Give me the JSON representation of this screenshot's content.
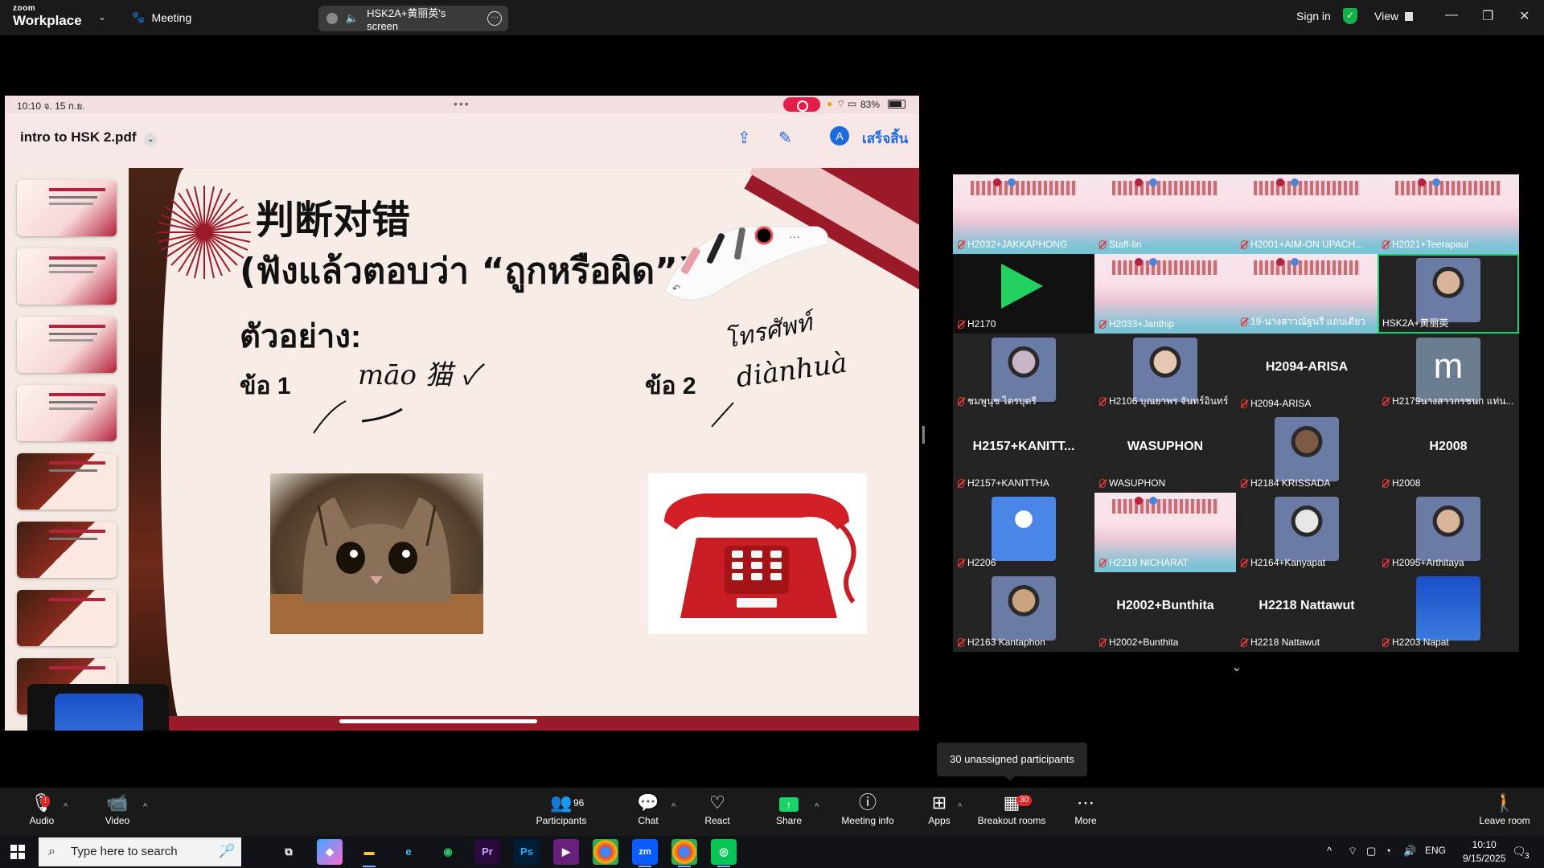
{
  "titlebar": {
    "logo_top": "zoom",
    "logo_bottom": "Workplace",
    "meeting_label": "Meeting",
    "screen_label": "HSK2A+黄丽英's screen",
    "signin_label": "Sign in",
    "view_label": "View"
  },
  "share": {
    "status_time": "10:10  จ. 15 ก.ย.",
    "battery": "83%",
    "pdf_title": "intro to HSK 2.pdf",
    "done_label": "เสร็จสิ้น",
    "slide": {
      "title_cn": "判断对错",
      "subtitle": "(ฟังแล้วตอบว่า “ถูกหรือผิด”)",
      "example": "ตัวอย่าง:",
      "q1": "ข้อ 1",
      "q2": "ข้อ 2",
      "hand_q1": "māo 猫 ✓",
      "hand_q2_thai": "โทรศัพท์",
      "hand_q2_pinyin": "diànhuà"
    }
  },
  "gallery": {
    "tiles": [
      {
        "name": "H2032+JAKKAPHONG",
        "kind": "poster"
      },
      {
        "name": "Staff-lin",
        "kind": "poster"
      },
      {
        "name": "H2001+AIM-ON UPACH...",
        "kind": "poster"
      },
      {
        "name": "H2021+Teerapaul",
        "kind": "poster"
      },
      {
        "name": "H2170",
        "kind": "logo"
      },
      {
        "name": "H2033+Janthip",
        "kind": "poster"
      },
      {
        "name": "19-นางสาวณัฐนรี แถบเดียว",
        "kind": "poster"
      },
      {
        "name": "HSK2A+黄丽英",
        "kind": "photo",
        "active": true
      },
      {
        "name": "ชมพูนุช ไตรบุตรี",
        "kind": "avatar"
      },
      {
        "name": "H2106 บุณยาพร จันทร์อินทร์",
        "kind": "photo"
      },
      {
        "name": "H2094-ARISA",
        "kind": "text",
        "big": "H2094-ARISA"
      },
      {
        "name": "H2179นางสาวกรชนก แท่น...",
        "kind": "letter",
        "big": "m"
      },
      {
        "name": "H2157+KANITTHA",
        "kind": "text",
        "big": "H2157+KANITT..."
      },
      {
        "name": "WASUPHON",
        "kind": "text",
        "big": "WASUPHON"
      },
      {
        "name": "H2184 KRISSADA",
        "kind": "photo"
      },
      {
        "name": "H2008",
        "kind": "text",
        "big": "H2008"
      },
      {
        "name": "H2206",
        "kind": "person"
      },
      {
        "name": "H2219 NICHARAT",
        "kind": "poster"
      },
      {
        "name": "H2164+Kanyapat",
        "kind": "sketch"
      },
      {
        "name": "H2095+Arthitaya",
        "kind": "photo"
      },
      {
        "name": "H2163 Kantaphon",
        "kind": "photo"
      },
      {
        "name": "H2002+Bunthita",
        "kind": "text",
        "big": "H2002+Bunthita"
      },
      {
        "name": "H2218 Nattawut",
        "kind": "text",
        "big": "H2218 Nattawut"
      },
      {
        "name": "H2203 Napat",
        "kind": "sky"
      }
    ]
  },
  "tooltip": "30 unassigned participants",
  "toolbar": {
    "audio": "Audio",
    "audio_badge": "!",
    "video": "Video",
    "participants": "Participants",
    "participants_count": "96",
    "chat": "Chat",
    "react": "React",
    "share": "Share",
    "meeting_info": "Meeting info",
    "apps": "Apps",
    "breakout": "Breakout rooms",
    "breakout_badge": "30",
    "more": "More",
    "leave": "Leave room"
  },
  "taskbar": {
    "search_placeholder": "Type here to search",
    "lang": "ENG",
    "time": "10:10",
    "date": "9/15/2025",
    "notif_count": "3"
  },
  "colors": {
    "accent": "#0b5cff",
    "share_green": "#19d36b",
    "danger": "#e02828",
    "slide_red": "#9b1a2a"
  }
}
